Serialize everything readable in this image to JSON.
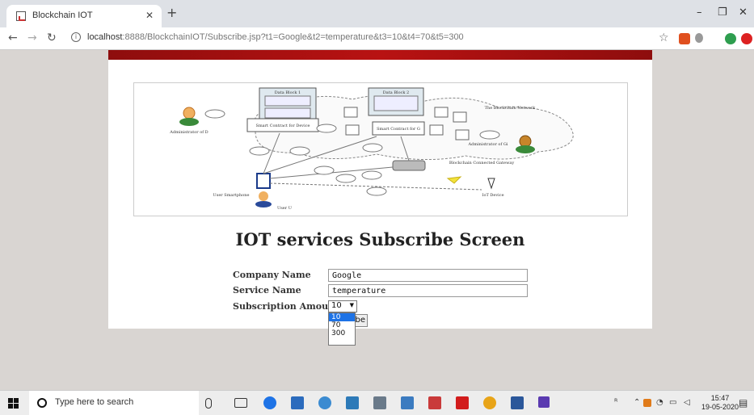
{
  "browser": {
    "tab_title": "Blockchain IOT",
    "url_host": "localhost",
    "url_rest": ":8888/BlockchainIOT/Subscribe.jsp?t1=Google&t2=temperature&t3=10&t4=70&t5=300"
  },
  "page": {
    "title": "IOT services Subscribe Screen",
    "form": {
      "company_label": "Company Name",
      "company_value": "Google",
      "service_label": "Service Name",
      "service_value": "temperature",
      "amount_label": "Subscription Amount",
      "amount_selected": "10",
      "amount_options": [
        "10",
        "70",
        "300"
      ],
      "submit_partial": "be"
    },
    "diagram": {
      "block1": "Data Block 1",
      "block2": "Data Block 2",
      "network": "The Blockchain Network",
      "admin_left": "Administrator of D",
      "admin_right": "Administrator of Gi",
      "smart_contract_left": "Smart Contract for Device",
      "smart_contract_right": "Smart Contract for G",
      "gateway": "Blockchain Connected Gateway",
      "user": "User Smartphone",
      "iot": "IoT Device",
      "user_ui": "User U"
    }
  },
  "taskbar": {
    "search_placeholder": "Type here to search",
    "time": "15:47",
    "date": "19-05-2020"
  },
  "colors": {
    "banner": "#a31010",
    "selected_option": "#1e73e6"
  }
}
